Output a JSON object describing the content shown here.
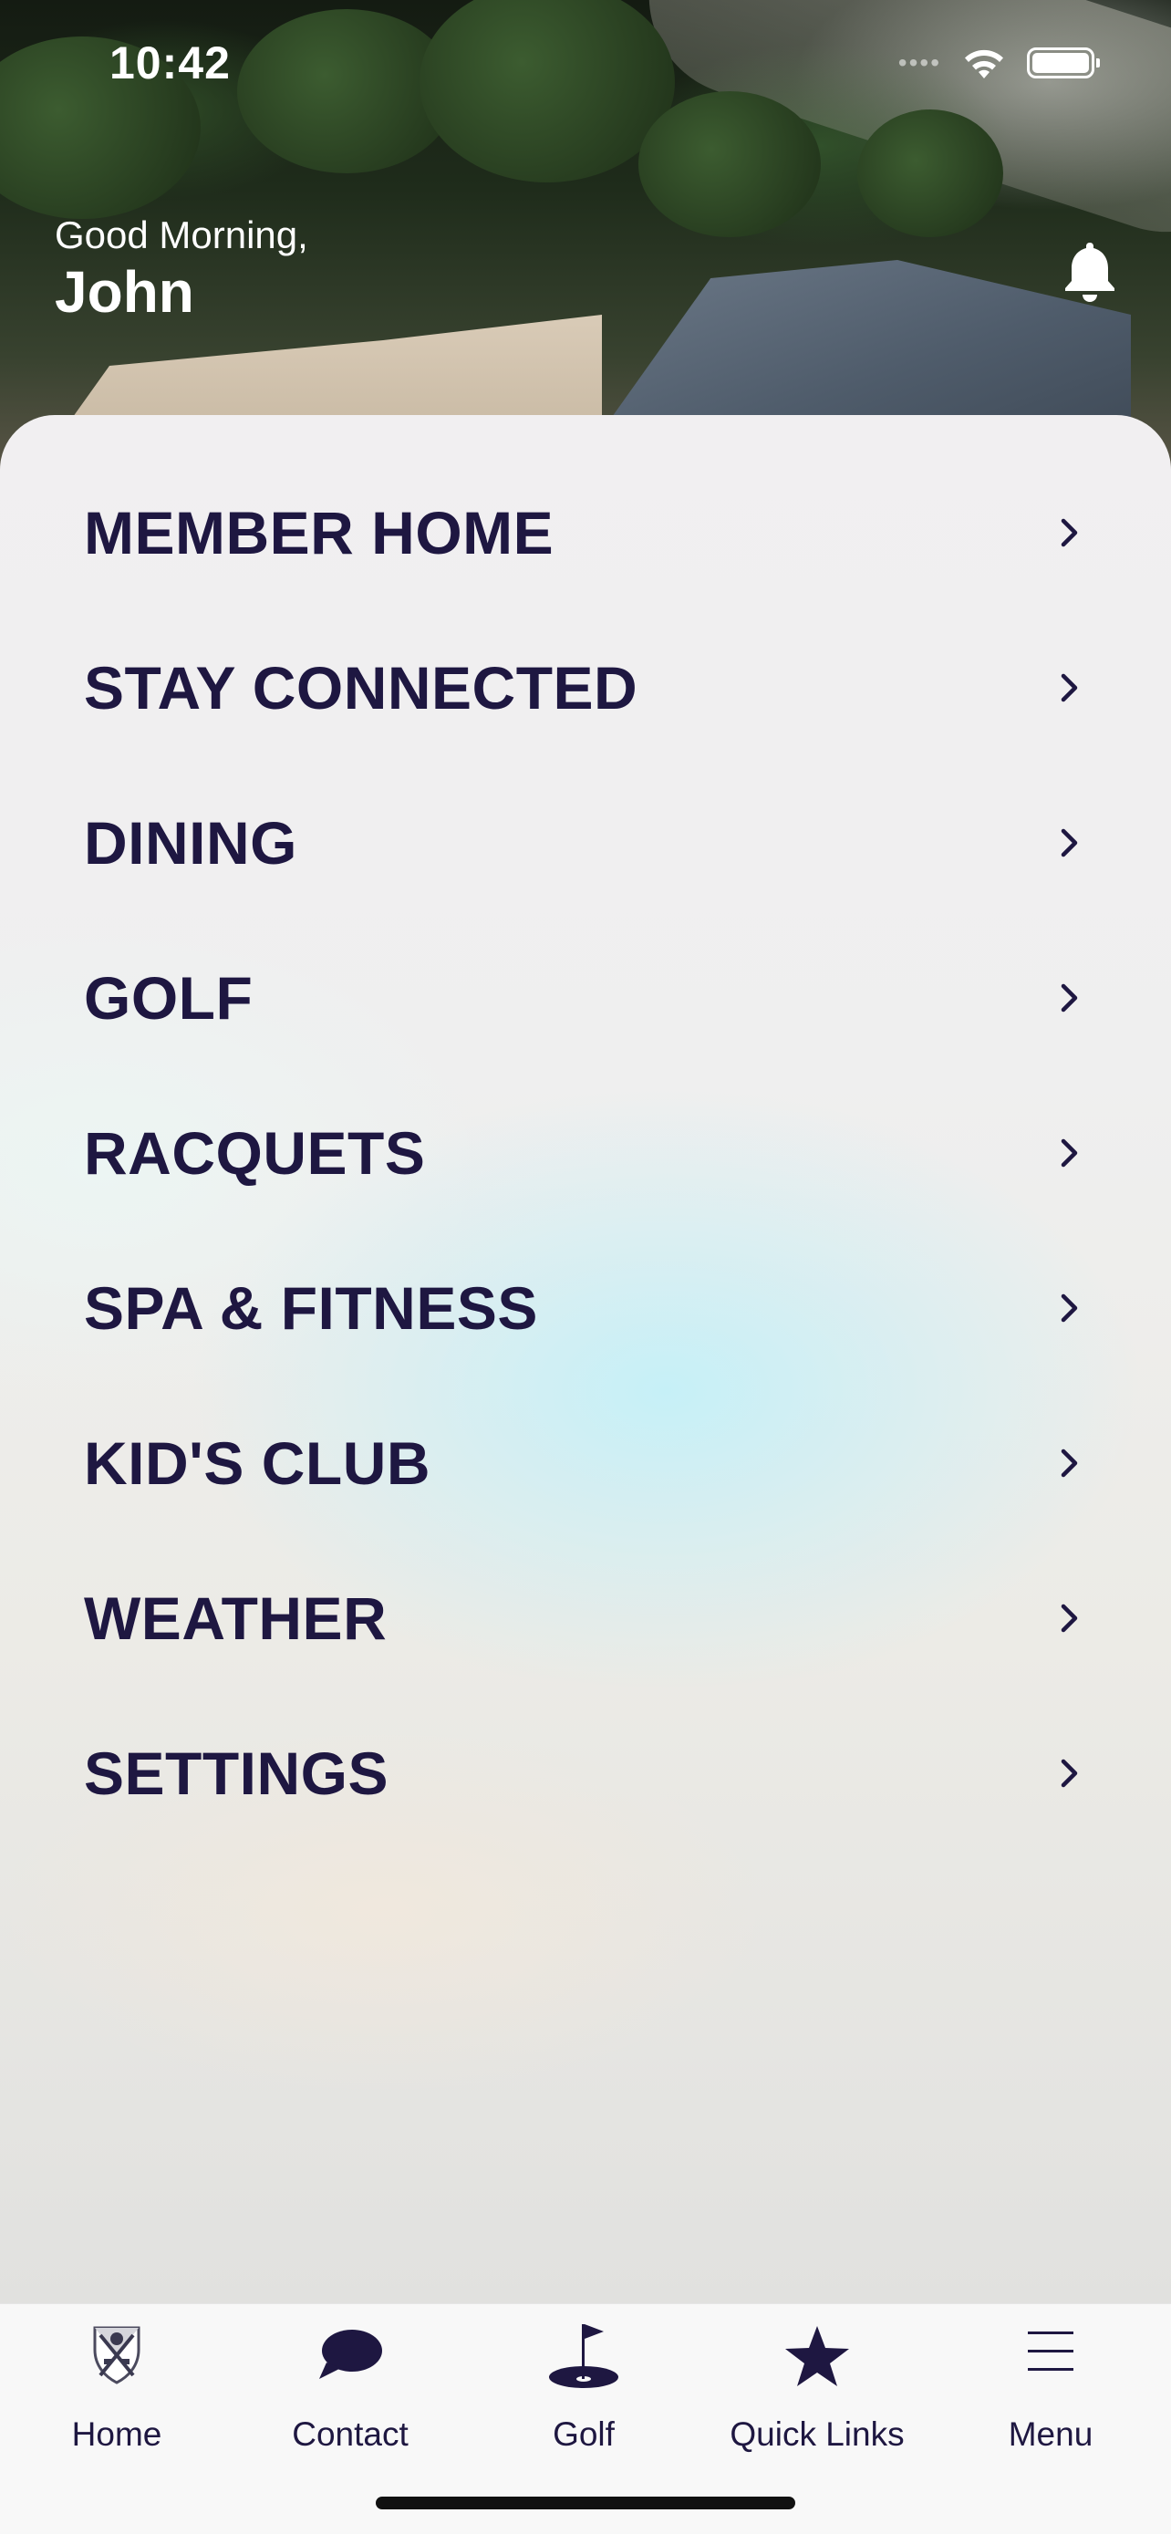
{
  "status_bar": {
    "time": "10:42"
  },
  "header": {
    "greeting": "Good Morning,",
    "name": "John"
  },
  "menu": {
    "items": [
      {
        "label": "MEMBER HOME"
      },
      {
        "label": "STAY CONNECTED"
      },
      {
        "label": "DINING"
      },
      {
        "label": "GOLF"
      },
      {
        "label": "RACQUETS"
      },
      {
        "label": "SPA & FITNESS"
      },
      {
        "label": "KID'S CLUB"
      },
      {
        "label": "WEATHER"
      },
      {
        "label": "SETTINGS"
      }
    ]
  },
  "tabbar": {
    "tabs": [
      {
        "label": "Home",
        "icon": "club-crest-icon"
      },
      {
        "label": "Contact",
        "icon": "chat-bubble-icon"
      },
      {
        "label": "Golf",
        "icon": "golf-flag-icon"
      },
      {
        "label": "Quick Links",
        "icon": "star-icon"
      },
      {
        "label": "Menu",
        "icon": "hamburger-menu-icon"
      }
    ]
  },
  "colors": {
    "primary_text": "#1e1741",
    "accent_cyan": "#c4f0f8",
    "tabbar_bg": "#f8f8f8"
  }
}
